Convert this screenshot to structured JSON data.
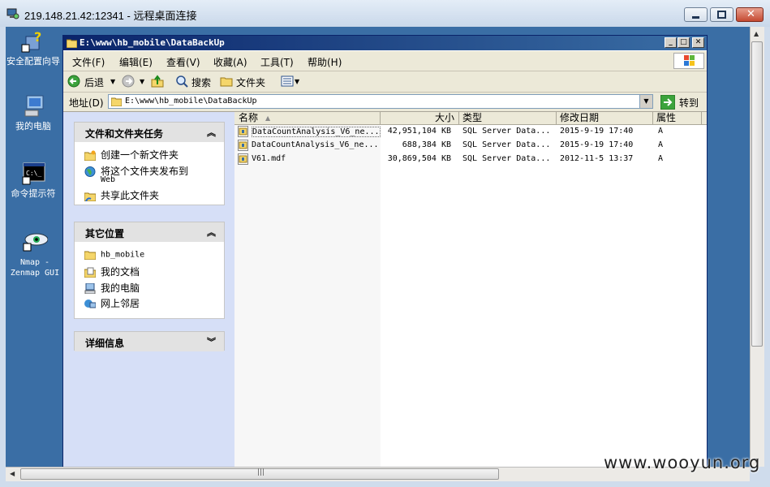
{
  "rdp": {
    "title": "219.148.21.42:12341 - 远程桌面连接"
  },
  "desktop": {
    "icons": [
      {
        "label": "安全配置向导",
        "icon": "security-wizard-icon"
      },
      {
        "label": "我的电脑",
        "icon": "computer-icon"
      },
      {
        "label": "命令提示符",
        "icon": "cmd-icon"
      },
      {
        "label": "Nmap - Zenmap GUI",
        "icon": "zenmap-eye-icon"
      }
    ]
  },
  "explorer": {
    "title": "E:\\www\\hb_mobile\\DataBackUp",
    "menu": [
      "文件(F)",
      "编辑(E)",
      "查看(V)",
      "收藏(A)",
      "工具(T)",
      "帮助(H)"
    ],
    "toolbar": {
      "back": "后退",
      "search": "搜索",
      "folders": "文件夹"
    },
    "address": {
      "label": "地址(D)",
      "value": "E:\\www\\hb_mobile\\DataBackUp",
      "go": "转到"
    },
    "tasks": {
      "title": "文件和文件夹任务",
      "items": [
        "创建一个新文件夹",
        "将这个文件夹发布到",
        "Web",
        "共享此文件夹"
      ]
    },
    "places": {
      "title": "其它位置",
      "items": [
        "hb_mobile",
        "我的文档",
        "我的电脑",
        "网上邻居"
      ]
    },
    "details": {
      "title": "详细信息"
    },
    "columns": [
      "名称",
      "大小",
      "类型",
      "修改日期",
      "属性"
    ],
    "files": [
      {
        "name": "DataCountAnalysis_V6_ne...",
        "size": "42,951,104 KB",
        "type": "SQL Server Data...",
        "date": "2015-9-19 17:40",
        "attr": "A"
      },
      {
        "name": "DataCountAnalysis_V6_ne...",
        "size": "688,384 KB",
        "type": "SQL Server Data...",
        "date": "2015-9-19 17:40",
        "attr": "A"
      },
      {
        "name": "V61.mdf",
        "size": "30,869,504 KB",
        "type": "SQL Server Data...",
        "date": "2012-11-5 13:37",
        "attr": "A"
      }
    ]
  },
  "watermark": "www.wooyun.org"
}
